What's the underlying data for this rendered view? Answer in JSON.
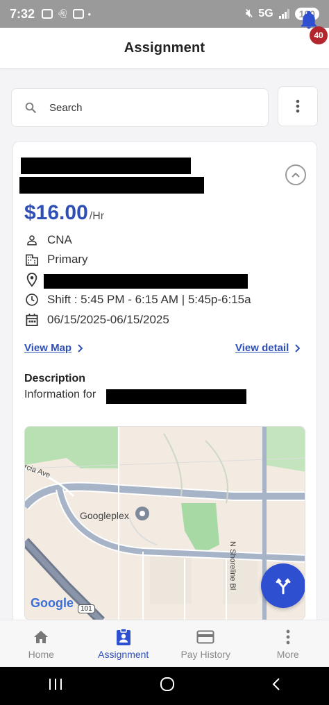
{
  "status_bar": {
    "time": "7:32",
    "network": "5G",
    "battery": "100",
    "icons": [
      "screenshot-icon",
      "snapchat-icon",
      "messages-icon",
      "dot-icon",
      "mute-icon",
      "signal-icon"
    ]
  },
  "header": {
    "title": "Assignment",
    "notification_count": "40",
    "accent": "#2f4fb7",
    "badge_color": "#b3262d"
  },
  "search": {
    "placeholder": "Search"
  },
  "assignment": {
    "rate": "$16.00",
    "rate_unit": "/Hr",
    "role": "CNA",
    "type": "Primary",
    "shift": "Shift : 5:45 PM - 6:15 AM | 5:45p-6:15a",
    "dates": "06/15/2025-06/15/2025",
    "view_map": "View Map",
    "view_detail": "View detail",
    "description_title": "Description",
    "description_text": "Information for"
  },
  "map": {
    "place_label": "Googleplex",
    "street_1": "rcia Ave",
    "street_2": "N Shoreline Bl",
    "highway": "101",
    "logo": "Google"
  },
  "bottom_nav": {
    "items": [
      {
        "label": "Home",
        "icon": "home-icon"
      },
      {
        "label": "Assignment",
        "icon": "assignment-icon"
      },
      {
        "label": "Pay History",
        "icon": "credit-card-icon"
      },
      {
        "label": "More",
        "icon": "more-vertical-icon"
      }
    ],
    "active_index": 1
  }
}
